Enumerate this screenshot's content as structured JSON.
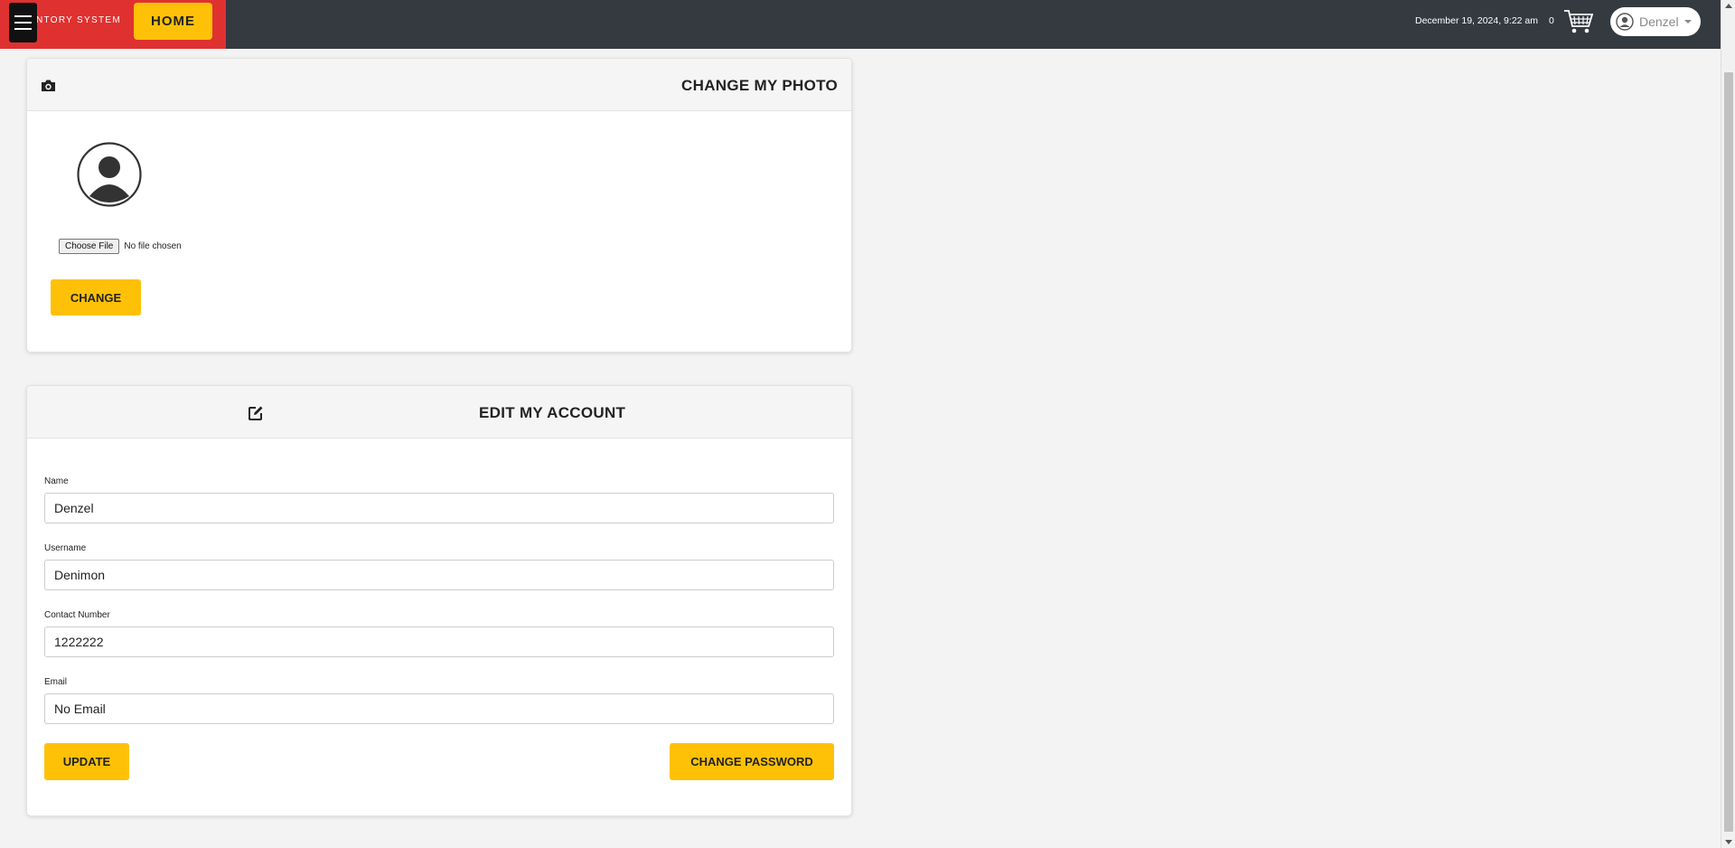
{
  "header": {
    "brand_text": "NTORY SYSTEM",
    "home_label": "HOME",
    "datetime": "December 19, 2024, 9:22 am",
    "cart_count": "0",
    "user_name": "Denzel"
  },
  "photo_panel": {
    "title": "CHANGE MY PHOTO",
    "choose_file_label": "Choose File",
    "no_file_text": "No file chosen",
    "change_label": "CHANGE"
  },
  "account_panel": {
    "title": "EDIT MY ACCOUNT",
    "fields": [
      {
        "label": "Name",
        "value": "Denzel"
      },
      {
        "label": "Username",
        "value": "Denimon"
      },
      {
        "label": "Contact Number",
        "value": "1222222"
      },
      {
        "label": "Email",
        "value": "No Email"
      }
    ],
    "update_label": "UPDATE",
    "change_password_label": "CHANGE PASSWORD"
  },
  "colors": {
    "topbar": "#343a40",
    "brand": "#e03131",
    "accent": "#ffc107"
  },
  "icons": [
    "menu-icon",
    "cart-icon",
    "user-icon",
    "camera-icon",
    "avatar-icon",
    "edit-icon"
  ]
}
